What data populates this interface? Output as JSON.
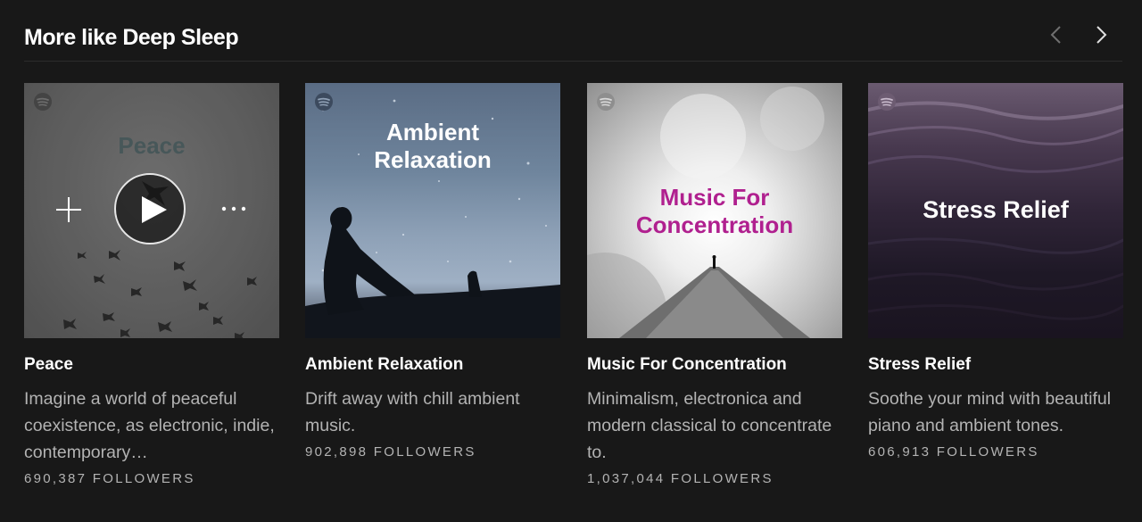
{
  "section": {
    "title": "More like Deep Sleep",
    "prev_icon": "chevron-left-icon",
    "next_icon": "chevron-right-icon"
  },
  "cards": [
    {
      "cover_text": "Peace",
      "name": "Peace",
      "description": "Imagine a world of peaceful coexistence, as electronic, indie, contemporary…",
      "followers": "690,387 FOLLOWERS"
    },
    {
      "cover_text": "Ambient Relaxation",
      "name": "Ambient Relaxation",
      "description": "Drift away with chill ambient music.",
      "followers": "902,898 FOLLOWERS"
    },
    {
      "cover_text": "Music For Concentration",
      "name": "Music For Concentration",
      "description": "Minimalism, electronica and modern classical to concentrate to.",
      "followers": "1,037,044 FOLLOWERS"
    },
    {
      "cover_text": "Stress Relief",
      "name": "Stress Relief",
      "description": "Soothe your mind with beautiful piano and ambient tones.",
      "followers": "606,913 FOLLOWERS"
    }
  ],
  "colors": {
    "background": "#181818",
    "text_primary": "#ffffff",
    "text_secondary": "#b3b3b3",
    "concentration_title": "#b0208f"
  }
}
